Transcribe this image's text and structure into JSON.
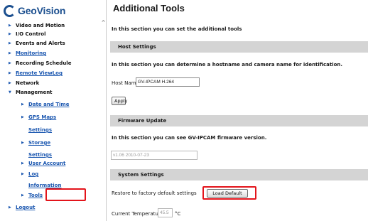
{
  "brand": {
    "name": "GeoVision"
  },
  "sidebar": {
    "scroll_up": "^",
    "items": [
      {
        "label": "Video and Motion"
      },
      {
        "label": "I/O Control"
      },
      {
        "label": "Events and Alerts"
      },
      {
        "label": "Monitoring"
      },
      {
        "label": "Recording Schedule"
      },
      {
        "label": "Remote ViewLog"
      },
      {
        "label": "Network"
      },
      {
        "label": "Management"
      },
      {
        "label": "Date and Time"
      },
      {
        "label": "GPS Maps"
      },
      {
        "label": "Settings"
      },
      {
        "label": "Storage"
      },
      {
        "label": "Settings"
      },
      {
        "label": "User Account"
      },
      {
        "label": "Log"
      },
      {
        "label": "Information"
      },
      {
        "label": "Tools"
      },
      {
        "label": "Logout"
      }
    ]
  },
  "main": {
    "title": "Additional Tools",
    "intro": "In this section you can set the additional tools",
    "host": {
      "header": "Host Settings",
      "description": "In this section you can determine a hostname and camera name for identification.",
      "name_label": "Host Name",
      "name_value": "GV-IPCAM H.264",
      "apply": "Apply"
    },
    "firmware": {
      "header": "Firmware Update",
      "description": "In this section you can see GV-IPCAM firmware version.",
      "version": "v1.06 2010-07-23"
    },
    "system": {
      "header": "System Settings",
      "restore_label": "Restore to factory default settings",
      "load_default": "Load Default",
      "temp_label": "Current Temperature:",
      "temp_value": "45.5",
      "temp_unit": "°C"
    }
  },
  "colors": {
    "accent": "#1b57b0",
    "highlight": "#e3141b",
    "header_bg": "#d4d4d4"
  }
}
